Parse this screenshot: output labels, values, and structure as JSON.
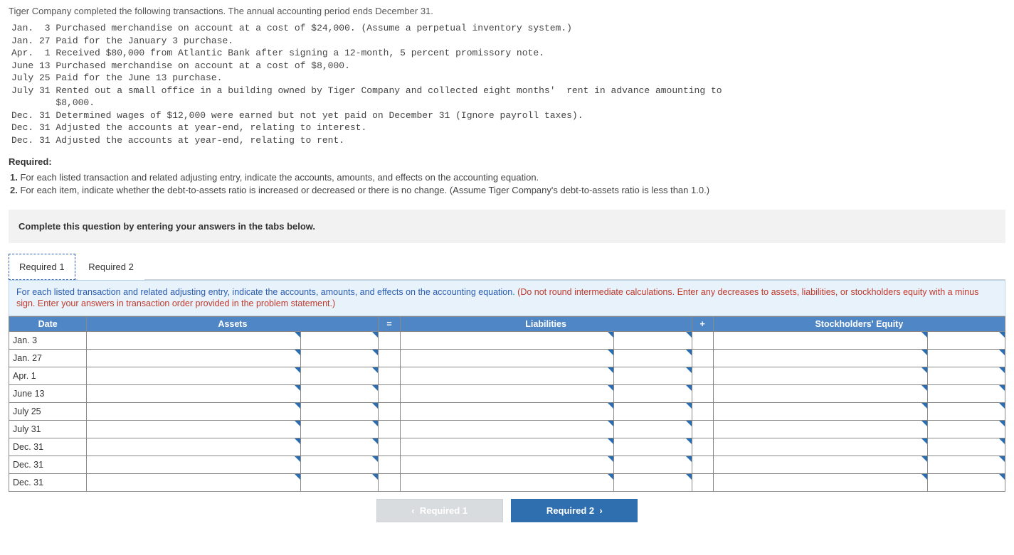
{
  "intro": "Tiger Company completed the following transactions. The annual accounting period ends December 31.",
  "transactions": [
    "Jan.  3 Purchased merchandise on account at a cost of $24,000. (Assume a perpetual inventory system.)",
    "Jan. 27 Paid for the January 3 purchase.",
    "Apr.  1 Received $80,000 from Atlantic Bank after signing a 12-month, 5 percent promissory note.",
    "June 13 Purchased merchandise on account at a cost of $8,000.",
    "July 25 Paid for the June 13 purchase.",
    "July 31 Rented out a small office in a building owned by Tiger Company and collected eight months'  rent in advance amounting to",
    "        $8,000.",
    "Dec. 31 Determined wages of $12,000 were earned but not yet paid on December 31 (Ignore payroll taxes).",
    "Dec. 31 Adjusted the accounts at year-end, relating to interest.",
    "Dec. 31 Adjusted the accounts at year-end, relating to rent."
  ],
  "required_label": "Required:",
  "requirements": [
    {
      "num": "1.",
      "text": " For each listed transaction and related adjusting entry, indicate the accounts, amounts, and effects  on the accounting equation."
    },
    {
      "num": "2.",
      "text": " For each item, indicate whether the debt-to-assets ratio is increased or decreased or there is no change. (Assume Tiger Company's debt-to-assets ratio is less than 1.0.)"
    }
  ],
  "complete_prompt": "Complete this question by entering your answers in the tabs below.",
  "tabs": {
    "t1": "Required 1",
    "t2": "Required 2"
  },
  "panel_instruction_main": "For each listed transaction and related adjusting entry, indicate the accounts, amounts, and effects on the accounting equation. ",
  "panel_instruction_warn": "(Do not round intermediate calculations. Enter any decreases to assets, liabilities, or stockholders equity with a minus sign. Enter your answers in transaction order provided in the problem statement.)",
  "table": {
    "headers": {
      "date": "Date",
      "assets": "Assets",
      "eq": "=",
      "liab": "Liabilities",
      "plus": "+",
      "se": "Stockholders' Equity"
    },
    "dates": [
      "Jan. 3",
      "Jan. 27",
      "Apr. 1",
      "June 13",
      "July 25",
      "July 31",
      "Dec. 31",
      "Dec. 31",
      "Dec. 31"
    ]
  },
  "nav": {
    "prev": "Required 1",
    "next": "Required 2"
  }
}
